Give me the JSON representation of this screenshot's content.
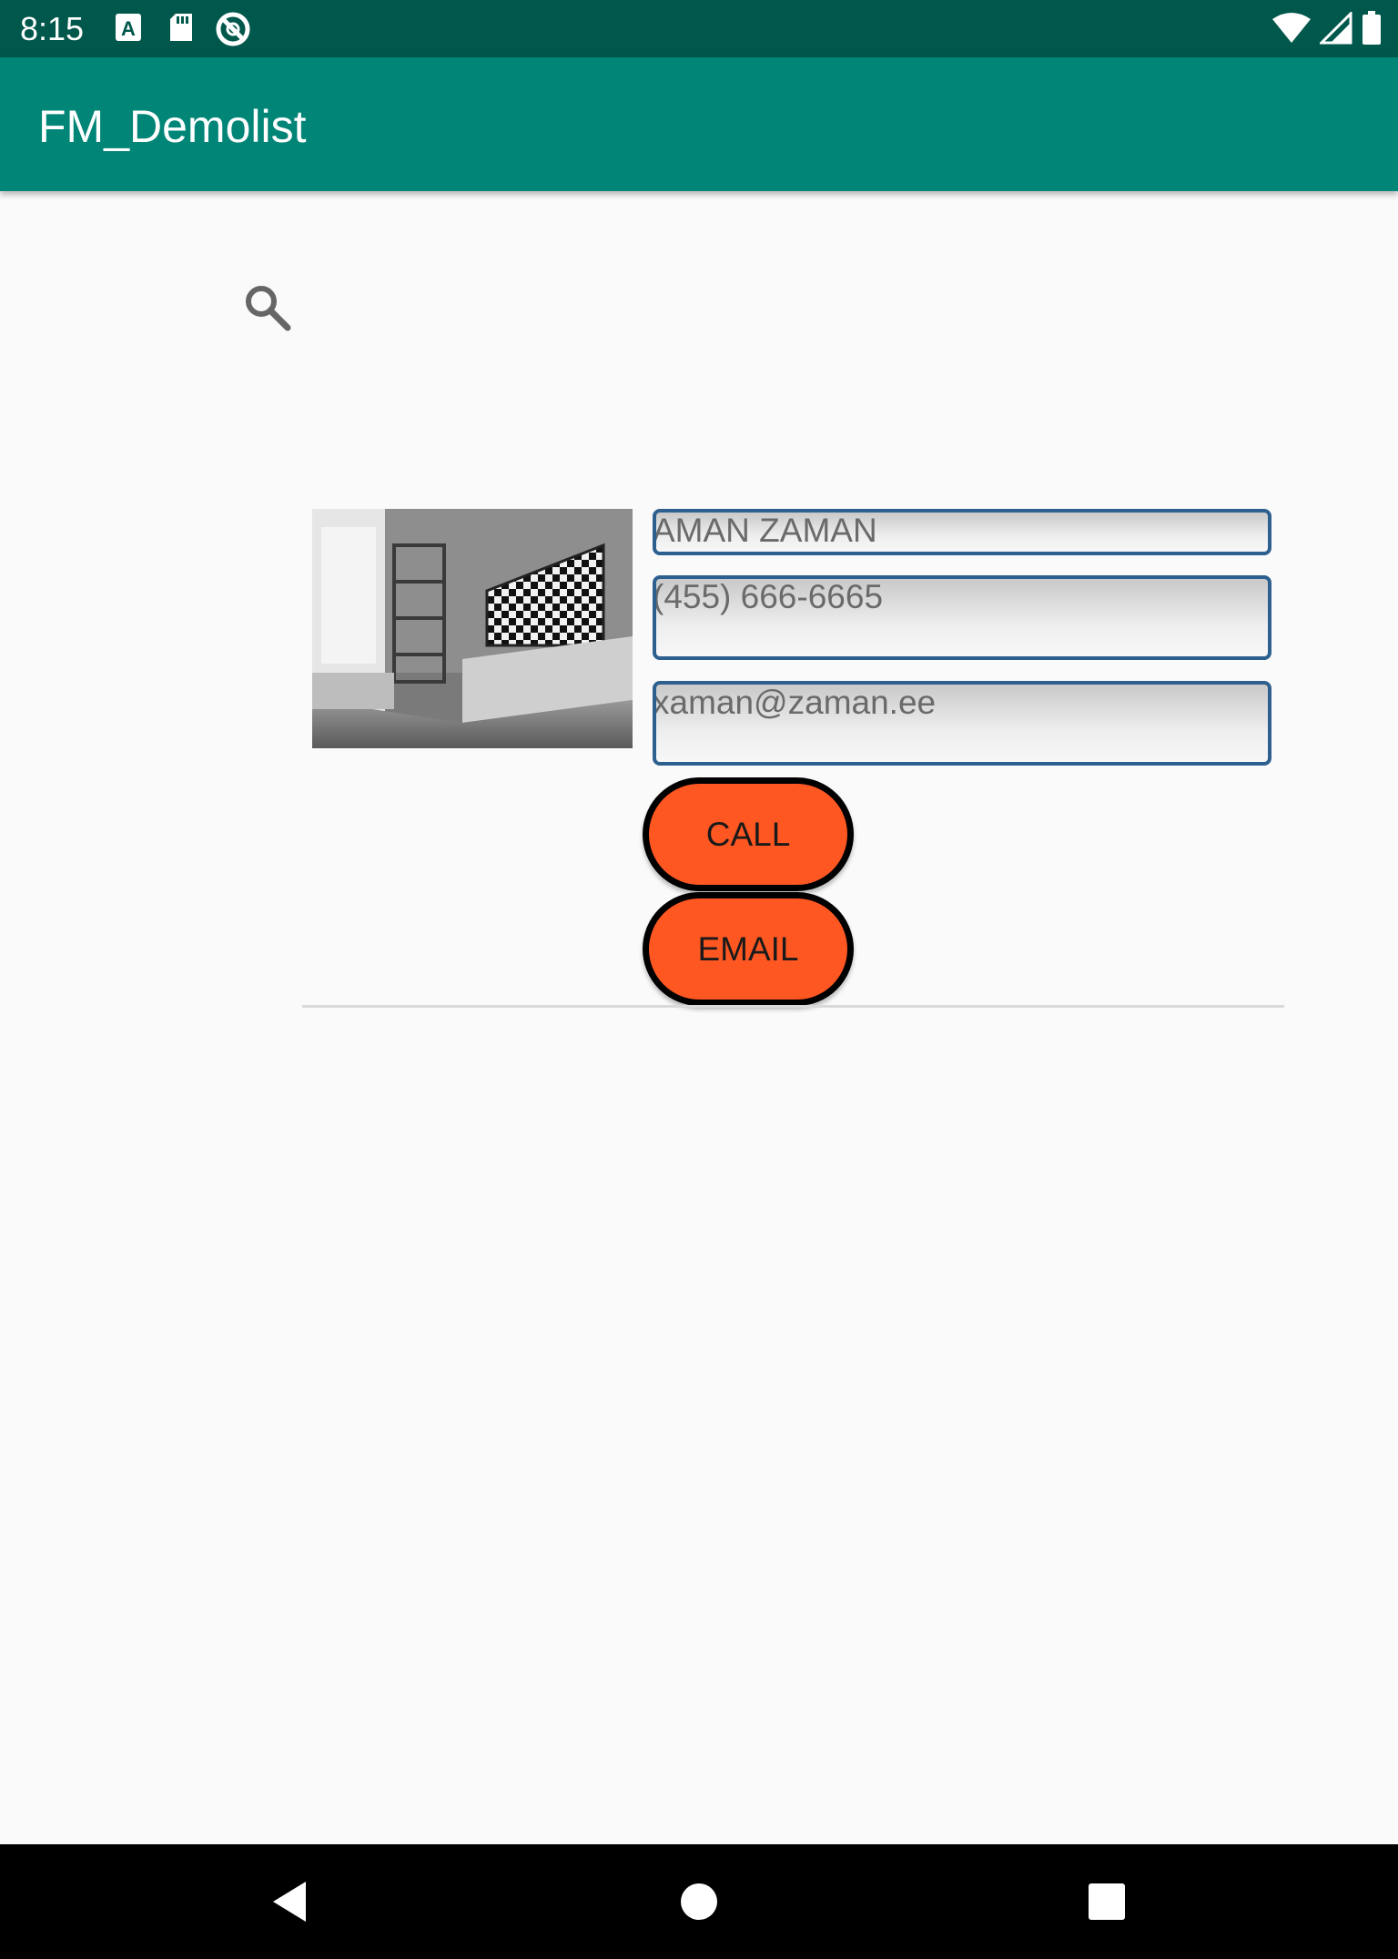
{
  "status_bar": {
    "time": "8:15",
    "left_icons": [
      "a-notification-icon",
      "sd-card-icon",
      "no-sync-icon"
    ],
    "right_icons": [
      "wifi-icon",
      "signal-icon",
      "battery-icon"
    ]
  },
  "app_bar": {
    "title": "FM_Demolist",
    "color": "#008577"
  },
  "search": {
    "icon": "search-icon"
  },
  "contact": {
    "name": "AMAN ZAMAN",
    "phone": "(455) 666-6665",
    "email": "xaman@zaman.ee",
    "call_label": "CALL",
    "email_label": "EMAIL",
    "button_color": "#ff5722"
  },
  "nav_bar": {
    "icons": [
      "back-icon",
      "home-icon",
      "recents-icon"
    ]
  }
}
